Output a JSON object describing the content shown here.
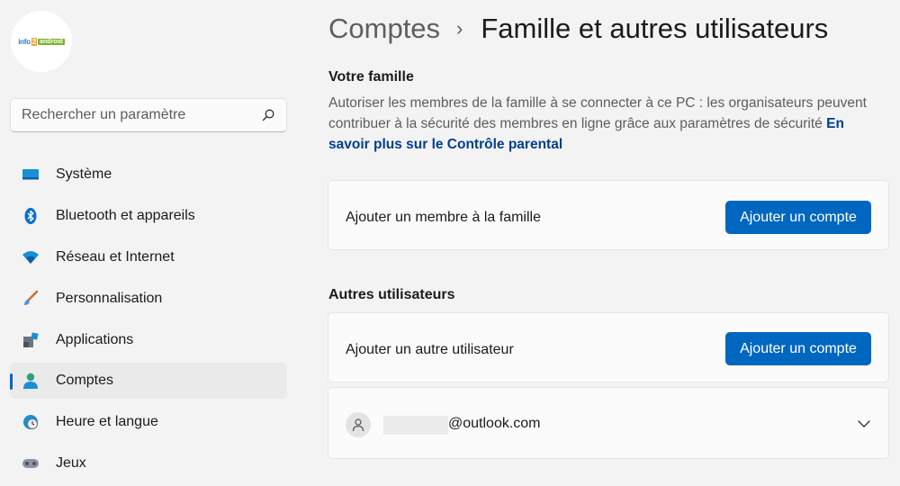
{
  "sidebar": {
    "logo": {
      "part1": "info",
      "part2": "2",
      "part3": "android"
    },
    "search": {
      "placeholder": "Rechercher un paramètre"
    },
    "items": [
      {
        "label": "Système",
        "icon": "monitor-icon"
      },
      {
        "label": "Bluetooth et appareils",
        "icon": "bluetooth-icon"
      },
      {
        "label": "Réseau et Internet",
        "icon": "wifi-icon"
      },
      {
        "label": "Personnalisation",
        "icon": "brush-icon"
      },
      {
        "label": "Applications",
        "icon": "apps-icon"
      },
      {
        "label": "Comptes",
        "icon": "person-icon",
        "active": true
      },
      {
        "label": "Heure et langue",
        "icon": "clock-globe-icon"
      },
      {
        "label": "Jeux",
        "icon": "gamepad-icon"
      }
    ]
  },
  "header": {
    "parent": "Comptes",
    "separator": "›",
    "title": "Famille et autres utilisateurs"
  },
  "family": {
    "title": "Votre famille",
    "description": "Autoriser les membres de la famille à se connecter à ce PC : les organisateurs peuvent contribuer à la sécurité des membres en ligne grâce aux paramètres de sécurité ",
    "link": "En savoir plus sur le Contrôle parental",
    "add_label": "Ajouter un membre à la famille",
    "add_button": "Ajouter un compte"
  },
  "others": {
    "title": "Autres utilisateurs",
    "add_label": "Ajouter un autre utilisateur",
    "add_button": "Ajouter un compte",
    "user_email": "@outlook.com"
  },
  "colors": {
    "accent": "#0067c0",
    "link": "#003e92",
    "background": "#f3f3f3"
  }
}
